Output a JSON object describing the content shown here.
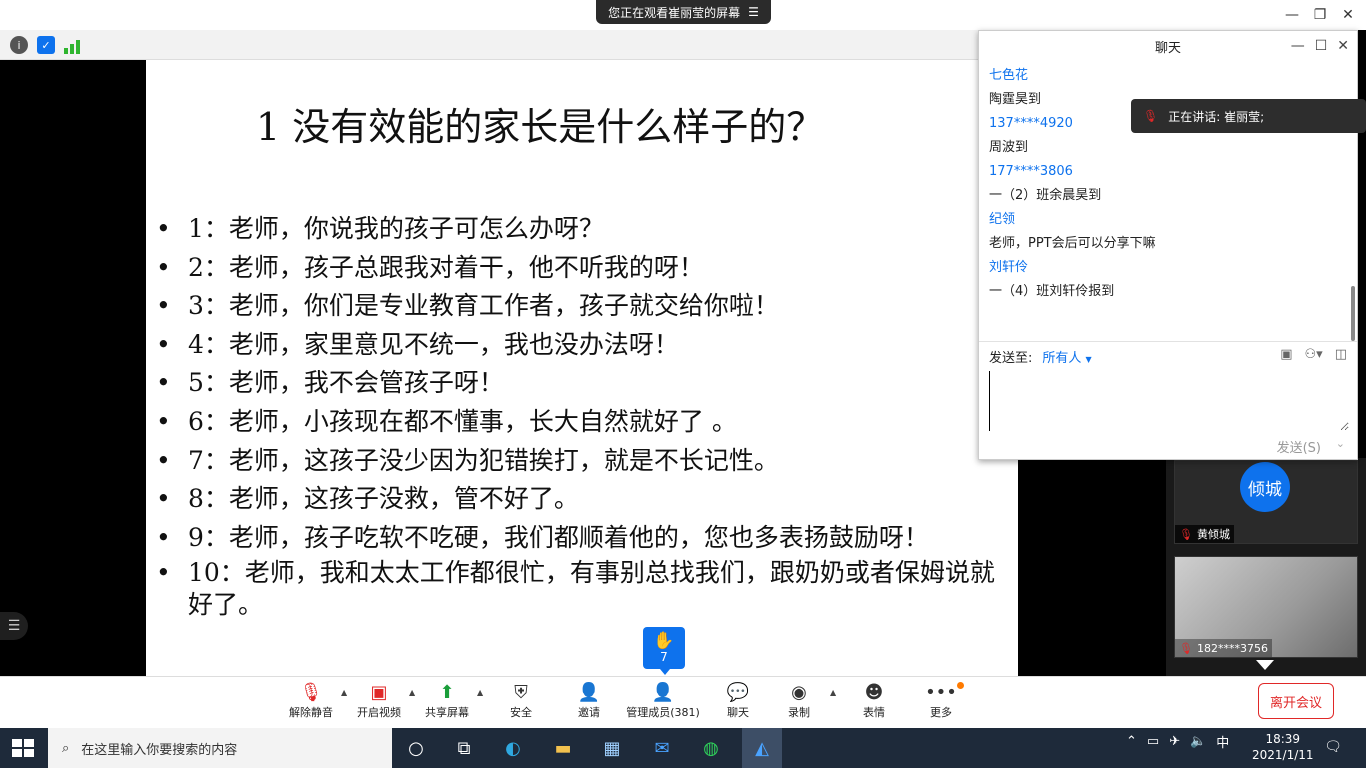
{
  "window": {
    "share_banner": "您正在观看崔丽莹的屏幕",
    "share_banner_icon": "list-icon"
  },
  "slide": {
    "title": "1 没有效能的家长是什么样子的？",
    "items": [
      "1：老师，你说我的孩子可怎么办呀？",
      "2：老师，孩子总跟我对着干，他不听我的呀！",
      "3：老师，你们是专业教育工作者，孩子就交给你啦！",
      "4：老师，家里意见不统一，我也没办法呀！",
      "5：老师，我不会管孩子呀！",
      "6：老师，小孩现在都不懂事，长大自然就好了 。",
      "7：老师，这孩子没少因为犯错挨打，就是不长记性。",
      "8：老师，这孩子没救，管不好了。",
      "9：老师，孩子吃软不吃硬，我们都顺着他的，您也多表扬鼓励呀！",
      "10：老师，我和太太工作都很忙，有事别总找我们，跟奶奶或者保姆说就好了。"
    ]
  },
  "raise_hand": {
    "count": "7"
  },
  "chat": {
    "title": "聊天",
    "messages": [
      {
        "sender": "七色花",
        "text": "陶霆昊到"
      },
      {
        "sender": "137****4920",
        "text": "周波到"
      },
      {
        "sender": "177****3806",
        "text": "一（2）班余晨昊到"
      },
      {
        "sender": "纪领",
        "text": "老师，PPT会后可以分享下嘛"
      },
      {
        "sender": "刘轩伶",
        "text": "一（4）班刘轩伶报到"
      }
    ],
    "send_to_label": "发送至:",
    "send_to_value": "所有人",
    "send_button": "发送(S)"
  },
  "speaking": {
    "label": "正在讲话: 崔丽莹;"
  },
  "participants": [
    {
      "avatar_text": "倾城",
      "name": "黄倾城"
    },
    {
      "name": "182****3756"
    }
  ],
  "toolbar": {
    "items": [
      {
        "label": "解除静音",
        "icon": "mic-muted-icon"
      },
      {
        "label": "开启视频",
        "icon": "video-off-icon"
      },
      {
        "label": "共享屏幕",
        "icon": "share-screen-icon"
      },
      {
        "label": "安全",
        "icon": "shield-icon"
      },
      {
        "label": "邀请",
        "icon": "add-user-icon"
      },
      {
        "label": "管理成员(381)",
        "icon": "participants-icon"
      },
      {
        "label": "聊天",
        "icon": "chat-icon"
      },
      {
        "label": "录制",
        "icon": "record-icon"
      },
      {
        "label": "表情",
        "icon": "emoji-icon"
      },
      {
        "label": "更多",
        "icon": "more-icon"
      }
    ],
    "leave": "离开会议"
  },
  "taskbar": {
    "search_placeholder": "在这里输入你要搜索的内容",
    "ime": "中",
    "time": "18:39",
    "date": "2021/1/11"
  },
  "colors": {
    "accent": "#0e72ed",
    "leave": "#e02828"
  }
}
